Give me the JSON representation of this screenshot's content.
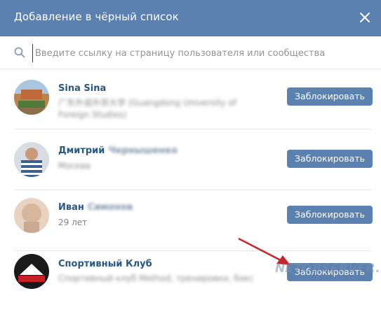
{
  "dialog": {
    "title": "Добавление в чёрный список",
    "close_icon": "close-icon"
  },
  "search": {
    "placeholder": "Введите ссылку на страницу пользователя или сообщества",
    "value": "",
    "icon": "search-icon"
  },
  "users": [
    {
      "name": "Sina Sina",
      "subtitle": "广东外语外贸大学 (Guangdong University of Foreign Studies)",
      "subtitle_blurred": true,
      "button_label": "Заблокировать"
    },
    {
      "name": "Дмитрий",
      "name_hidden": "Чернышенко",
      "subtitle": "Москва",
      "subtitle_blurred": true,
      "button_label": "Заблокировать"
    },
    {
      "name": "Иван",
      "name_hidden": "Симонов",
      "subtitle": "29 лет",
      "subtitle_blurred": false,
      "button_label": "Заблокировать"
    },
    {
      "name": "Спортивный Клуб",
      "subtitle": "Спортивный клуб Method, тренировки, бокс",
      "subtitle_blurred": true,
      "button_label": "Заблокировать"
    }
  ],
  "watermark": "NETOBSERVER.RU",
  "colors": {
    "header_bg": "#5b81b1",
    "button_bg": "#5b81b1",
    "name_link": "#2a5885",
    "arrow": "#c0282d"
  }
}
